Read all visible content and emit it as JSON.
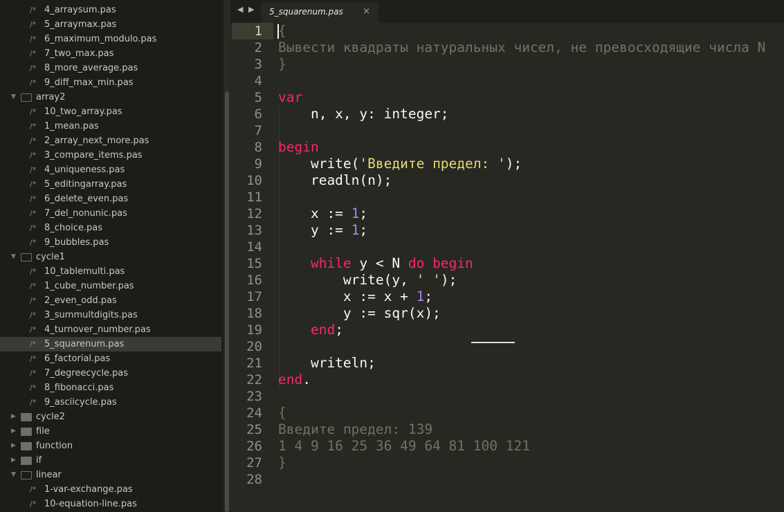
{
  "sidebar": {
    "rows": [
      {
        "type": "file",
        "name": "4_arraysum.pas"
      },
      {
        "type": "file",
        "name": "5_arraymax.pas"
      },
      {
        "type": "file",
        "name": "6_maximum_modulo.pas"
      },
      {
        "type": "file",
        "name": "7_two_max.pas"
      },
      {
        "type": "file",
        "name": "8_more_average.pas"
      },
      {
        "type": "file",
        "name": "9_diff_max_min.pas"
      },
      {
        "type": "folder",
        "open": true,
        "name": "array2"
      },
      {
        "type": "file",
        "name": "10_two_array.pas"
      },
      {
        "type": "file",
        "name": "1_mean.pas"
      },
      {
        "type": "file",
        "name": "2_array_next_more.pas"
      },
      {
        "type": "file",
        "name": "3_compare_items.pas"
      },
      {
        "type": "file",
        "name": "4_uniqueness.pas"
      },
      {
        "type": "file",
        "name": "5_editingarray.pas"
      },
      {
        "type": "file",
        "name": "6_delete_even.pas"
      },
      {
        "type": "file",
        "name": "7_del_nonunic.pas"
      },
      {
        "type": "file",
        "name": "8_choice.pas"
      },
      {
        "type": "file",
        "name": "9_bubbles.pas"
      },
      {
        "type": "folder",
        "open": true,
        "name": "cycle1"
      },
      {
        "type": "file",
        "name": "10_tablemulti.pas"
      },
      {
        "type": "file",
        "name": "1_cube_number.pas"
      },
      {
        "type": "file",
        "name": "2_even_odd.pas"
      },
      {
        "type": "file",
        "name": "3_summultdigits.pas"
      },
      {
        "type": "file",
        "name": "4_turnover_number.pas"
      },
      {
        "type": "file",
        "name": "5_squarenum.pas",
        "selected": true
      },
      {
        "type": "file",
        "name": "6_factorial.pas"
      },
      {
        "type": "file",
        "name": "7_degreecycle.pas"
      },
      {
        "type": "file",
        "name": "8_fibonacci.pas"
      },
      {
        "type": "file",
        "name": "9_asciicycle.pas"
      },
      {
        "type": "folder",
        "open": false,
        "name": "cycle2"
      },
      {
        "type": "folder",
        "open": false,
        "name": "file"
      },
      {
        "type": "folder",
        "open": false,
        "name": "function"
      },
      {
        "type": "folder",
        "open": false,
        "name": "if"
      },
      {
        "type": "folder",
        "open": true,
        "name": "linear"
      },
      {
        "type": "file",
        "name": "1-var-exchange.pas"
      },
      {
        "type": "file",
        "name": "10-equation-line.pas"
      }
    ],
    "file_icon": "/*"
  },
  "tab": {
    "title": "5_squarenum.pas",
    "close": "×",
    "nav": "◀ ▶"
  },
  "editor": {
    "current_line": 1,
    "lines": [
      [
        [
          "{",
          "cm"
        ]
      ],
      [
        [
          "Вывести квадраты натуральных чисел, не превосходящие числа N",
          "cm"
        ]
      ],
      [
        [
          "}",
          "cm"
        ]
      ],
      [],
      [
        [
          "var",
          "kw"
        ]
      ],
      [
        [
          "    n, x, y: integer;",
          ""
        ]
      ],
      [],
      [
        [
          "begin",
          "kw"
        ]
      ],
      [
        [
          "    write(",
          ""
        ],
        [
          "'Введите предел: '",
          "st"
        ],
        [
          ");",
          ""
        ]
      ],
      [
        [
          "    readln(n);",
          ""
        ]
      ],
      [],
      [
        [
          "    x := ",
          ""
        ],
        [
          "1",
          "nu"
        ],
        [
          ";",
          ""
        ]
      ],
      [
        [
          "    y := ",
          ""
        ],
        [
          "1",
          "nu"
        ],
        [
          ";",
          ""
        ]
      ],
      [],
      [
        [
          "    ",
          ""
        ],
        [
          "while",
          "kw"
        ],
        [
          " y < N ",
          ""
        ],
        [
          "do",
          "kw"
        ],
        [
          " ",
          ""
        ],
        [
          "begin",
          "kw"
        ]
      ],
      [
        [
          "        write(y, ",
          ""
        ],
        [
          "' '",
          "st"
        ],
        [
          ");",
          ""
        ]
      ],
      [
        [
          "        x := x + ",
          ""
        ],
        [
          "1",
          "nu"
        ],
        [
          ";",
          ""
        ]
      ],
      [
        [
          "        y := sqr(x);",
          ""
        ]
      ],
      [
        [
          "    ",
          ""
        ],
        [
          "end",
          "kw"
        ],
        [
          ";",
          ""
        ]
      ],
      [],
      [
        [
          "    writeln;",
          ""
        ]
      ],
      [
        [
          "end",
          "kw"
        ],
        [
          ".",
          ""
        ]
      ],
      [],
      [
        [
          "{",
          "cm"
        ]
      ],
      [
        [
          "Введите предел: 139",
          "cm"
        ]
      ],
      [
        [
          "1 4 9 16 25 36 49 64 81 100 121",
          "cm"
        ]
      ],
      [
        [
          "}",
          "cm"
        ]
      ],
      []
    ]
  }
}
